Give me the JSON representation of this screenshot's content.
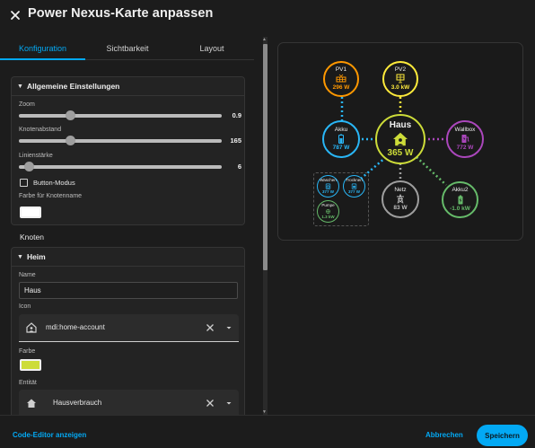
{
  "dialog": {
    "title": "Power Nexus-Karte anpassen"
  },
  "tabs": [
    {
      "label": "Konfiguration",
      "active": true
    },
    {
      "label": "Sichtbarkeit",
      "active": false
    },
    {
      "label": "Layout",
      "active": false
    }
  ],
  "general": {
    "title": "Allgemeine Einstellungen",
    "zoom_label": "Zoom",
    "zoom_value": "0.9",
    "node_distance_label": "Knotenabstand",
    "node_distance_value": "165",
    "line_width_label": "Linienstärke",
    "line_width_value": "6",
    "button_mode_label": "Button-Modus",
    "button_mode_checked": false,
    "node_name_color_label": "Farbe für Knotenname",
    "node_name_color": "#ffffff"
  },
  "nodes_section": {
    "title": "Knoten"
  },
  "home": {
    "title": "Heim",
    "name_label": "Name",
    "name_value": "Haus",
    "icon_label": "Icon",
    "icon_value": "mdi:home-account",
    "color_label": "Farbe",
    "color_value": "#cddc39",
    "entity_label": "Entität",
    "entity_value": "Hausverbrauch"
  },
  "preview": {
    "nodes": {
      "pv1": {
        "name": "PV1",
        "value": "296 W",
        "color": "#ff9800",
        "icon": "solar-panel-icon"
      },
      "pv2": {
        "name": "PV2",
        "value": "3.0 kW",
        "color": "#ffeb3b",
        "icon": "solar-panel-icon"
      },
      "akku": {
        "name": "Akku",
        "value": "787 W",
        "color": "#29b6f6",
        "icon": "battery-icon"
      },
      "haus": {
        "name": "Haus",
        "value": "365 W",
        "color": "#cddc39",
        "icon": "home-account-icon"
      },
      "wallbox": {
        "name": "Wallbox",
        "value": "772 W",
        "color": "#ab47bc",
        "icon": "ev-station-icon"
      },
      "waschen": {
        "name": "Waschen",
        "value": "377 W",
        "color": "#29b6f6",
        "icon": "washing-machine-icon"
      },
      "trocknen": {
        "name": "Trocknen",
        "value": "377 W",
        "color": "#29b6f6",
        "icon": "dryer-icon"
      },
      "pumpe": {
        "name": "Pumpe",
        "value": "1.3 kW",
        "color": "#66bb6a",
        "icon": "pump-icon"
      },
      "netz": {
        "name": "Netz",
        "value": "83 W",
        "color": "#9e9e9e",
        "icon": "transmission-tower-icon"
      },
      "akku2": {
        "name": "Akku2",
        "value": "-1.0 kW",
        "color": "#66bb6a",
        "icon": "battery-charging-icon"
      }
    }
  },
  "footer": {
    "code_editor_label": "Code-Editor anzeigen",
    "cancel_label": "Abbrechen",
    "save_label": "Speichern"
  },
  "colors": {
    "accent": "#03a9f4",
    "background": "#1c1c1c"
  }
}
